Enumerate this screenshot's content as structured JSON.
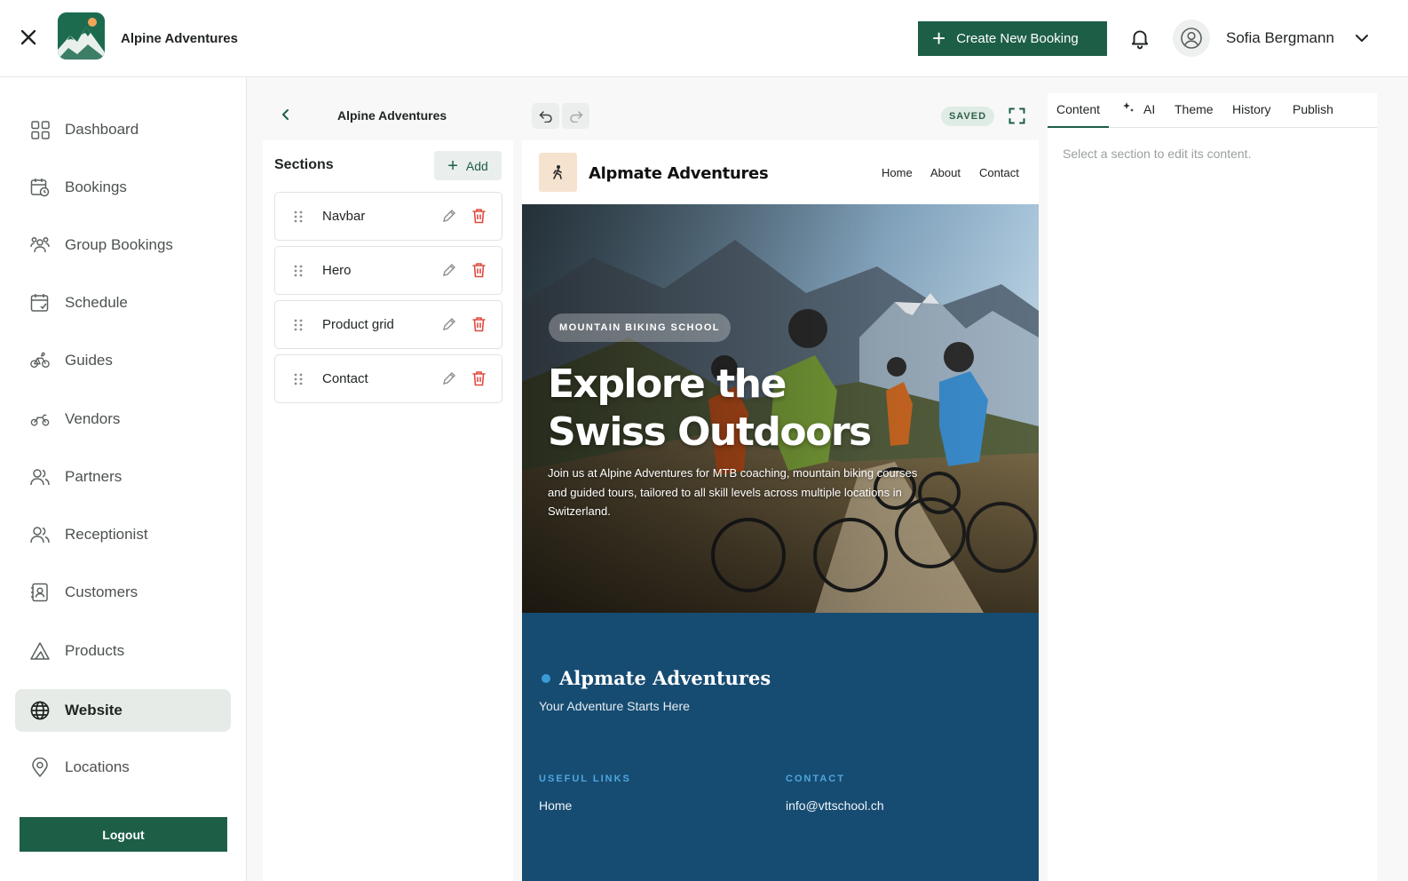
{
  "header": {
    "brand_name": "Alpine Adventures",
    "create_booking_label": "Create New Booking",
    "user_name": "Sofia Bergmann"
  },
  "sidebar": {
    "items": [
      {
        "label": "Dashboard",
        "icon": "grid-icon"
      },
      {
        "label": "Bookings",
        "icon": "calendar-clock-icon"
      },
      {
        "label": "Group Bookings",
        "icon": "users-group-icon"
      },
      {
        "label": "Schedule",
        "icon": "calendar-check-icon"
      },
      {
        "label": "Guides",
        "icon": "bike-icon"
      },
      {
        "label": "Vendors",
        "icon": "motorbike-icon"
      },
      {
        "label": "Partners",
        "icon": "users-icon"
      },
      {
        "label": "Receptionist",
        "icon": "users-icon"
      },
      {
        "label": "Customers",
        "icon": "contact-card-icon"
      },
      {
        "label": "Products",
        "icon": "mountain-icon"
      },
      {
        "label": "Website",
        "icon": "globe-icon",
        "active": true
      },
      {
        "label": "Locations",
        "icon": "map-pin-icon"
      }
    ],
    "logout_label": "Logout"
  },
  "editor": {
    "project_name": "Alpine Adventures",
    "sections_title": "Sections",
    "add_label": "Add",
    "sections": [
      {
        "label": "Navbar"
      },
      {
        "label": "Hero"
      },
      {
        "label": "Product grid"
      },
      {
        "label": "Contact"
      }
    ],
    "saved_label": "SAVED"
  },
  "preview": {
    "nav": {
      "brand": "Alpmate Adventures",
      "links": [
        "Home",
        "About",
        "Contact"
      ]
    },
    "hero": {
      "badge": "MOUNTAIN BIKING SCHOOL",
      "title": "Explore the Swiss Outdoors",
      "description": "Join us at Alpine Adventures for MTB coaching, mountain biking courses and guided tours, tailored to all skill levels across multiple locations in Switzerland."
    },
    "footer": {
      "brand": "Alpmate Adventures",
      "tagline": "Your Adventure Starts Here",
      "useful_links_heading": "USEFUL LINKS",
      "useful_links": [
        "Home"
      ],
      "contact_heading": "CONTACT",
      "contact_email": "info@vttschool.ch"
    }
  },
  "right_panel": {
    "tabs": [
      "Content",
      "AI",
      "Theme",
      "History",
      "Publish"
    ],
    "active_tab": "Content",
    "empty_message": "Select a section to edit its content."
  },
  "colors": {
    "brand_green": "#1d5e47",
    "footer_blue": "#174c72",
    "delete_red": "#e04a3f"
  }
}
